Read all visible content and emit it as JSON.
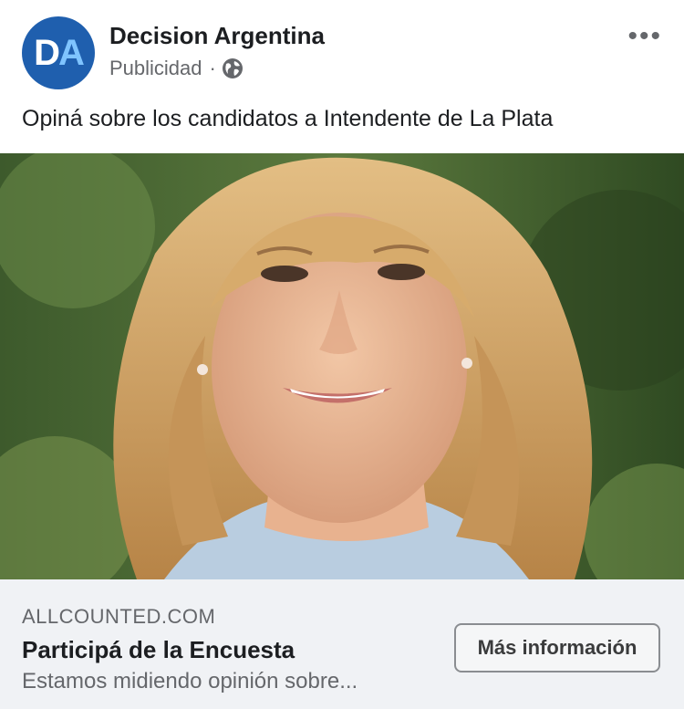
{
  "post": {
    "page_name": "Decision Argentina",
    "avatar_letters": "DA",
    "sponsored_label": "Publicidad",
    "separator": "·",
    "audience_icon": "globe-icon",
    "more_icon": "more-options-icon",
    "more_glyph": "•••",
    "text": "Opiná sobre los candidatos a Intendente de La Plata"
  },
  "image": {
    "subject": "portrait photo"
  },
  "link_card": {
    "domain": "ALLCOUNTED.COM",
    "title": "Participá de la Encuesta",
    "description": "Estamos midiendo opinión sobre...",
    "cta_label": "Más información"
  },
  "colors": {
    "avatar_bg": "#1f5fae",
    "secondary_text": "#65676b",
    "card_bg": "#f0f2f5"
  }
}
